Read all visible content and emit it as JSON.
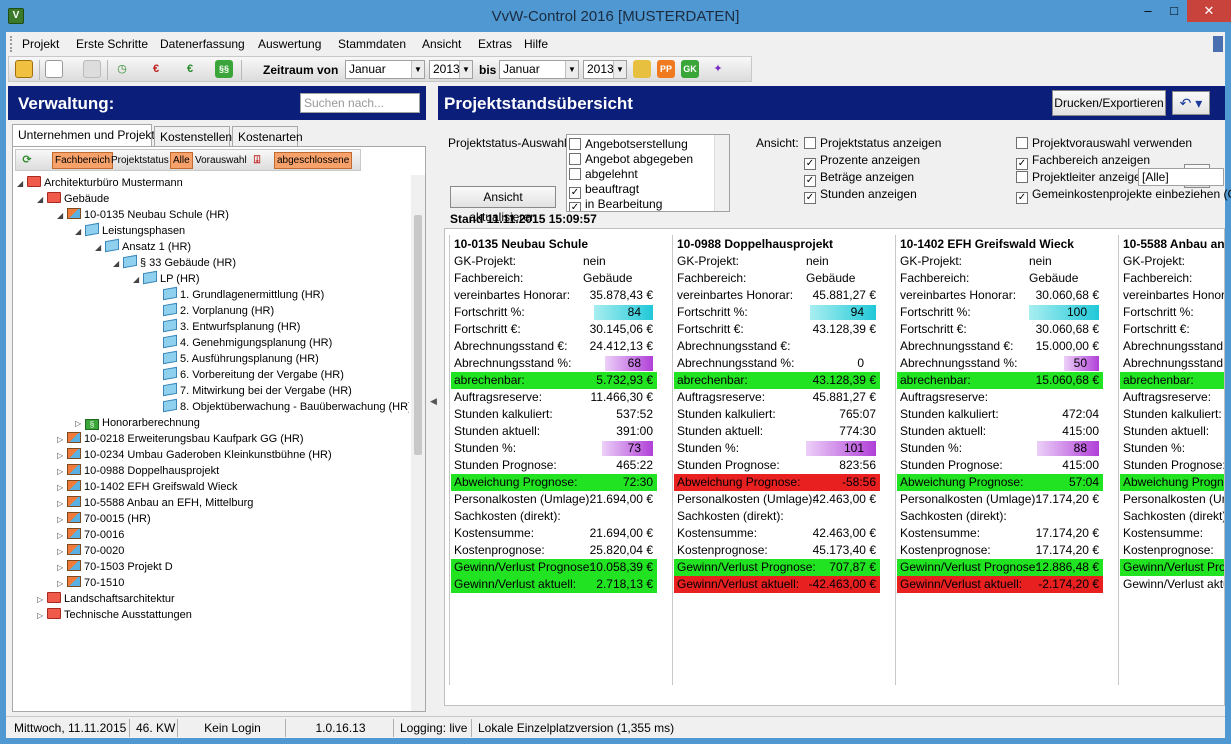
{
  "window": {
    "title": "VvW-Control 2016 [MUSTERDATEN]"
  },
  "menu": [
    "Projekt",
    "Erste Schritte",
    "Datenerfassung",
    "Auswertung",
    "Stammdaten",
    "Ansicht",
    "Extras",
    "Hilfe"
  ],
  "toolbar": {
    "zeitraum_label": "Zeitraum von",
    "from_month": "Januar",
    "from_year": "2013",
    "bis_label": "bis",
    "to_month": "Januar",
    "to_year": "2013"
  },
  "left": {
    "title": "Verwaltung:",
    "search_placeholder": "Suchen nach...",
    "tabs": [
      "Unternehmen und Projekte",
      "Kostenstellen",
      "Kostenarten"
    ],
    "filters": [
      "Fachbereich",
      "Projektstatus",
      "Alle",
      "Vorauswahl",
      "abgeschlossene"
    ],
    "tree": [
      "Architekturbüro Mustermann",
      "Gebäude",
      "10-0135 Neubau Schule (HR)",
      "Leistungsphasen",
      "Ansatz 1 (HR)",
      "§ 33 Gebäude (HR)",
      "LP (HR)",
      "1. Grundlagenermittlung (HR)",
      "2. Vorplanung (HR)",
      "3. Entwurfsplanung (HR)",
      "4. Genehmigungsplanung (HR)",
      "5. Ausführungsplanung (HR)",
      "6. Vorbereitung der Vergabe (HR)",
      "7. Mitwirkung bei der Vergabe (HR)",
      "8. Objektüberwachung - Bauüberwachung (HR)",
      "Honorarberechnung",
      "10-0218 Erweiterungsbau Kaufpark GG (HR)",
      "10-0234 Umbau Gaderoben Kleinkunstbühne (HR)",
      "10-0988 Doppelhausprojekt",
      "10-1402 EFH Greifswald Wieck",
      "10-5588 Anbau an EFH, Mittelburg",
      "70-0015 (HR)",
      "70-0016",
      "70-0020",
      "70-1503 Projekt D",
      "70-1510",
      "Landschaftsarchitektur",
      "Technische Ausstattungen"
    ]
  },
  "right": {
    "title": "Projektstandsübersicht",
    "print_button": "Drucken/Exportieren",
    "status_label": "Projektstatus-Auswahl:",
    "status_items": [
      {
        "label": "Angebotserstellung",
        "checked": false
      },
      {
        "label": "Angebot abgegeben",
        "checked": false
      },
      {
        "label": "abgelehnt",
        "checked": false
      },
      {
        "label": "beauftragt",
        "checked": true
      },
      {
        "label": "in Bearbeitung",
        "checked": true
      }
    ],
    "refresh_button": "Ansicht aktualisieren",
    "stand": "Stand 11.11.2015 15:09:57",
    "ansicht_label": "Ansicht:",
    "ansicht_options": [
      {
        "label": "Projektstatus anzeigen",
        "checked": false
      },
      {
        "label": "Prozente anzeigen",
        "checked": true
      },
      {
        "label": "Beträge anzeigen",
        "checked": true
      },
      {
        "label": "Stunden anzeigen",
        "checked": true
      }
    ],
    "other_options": [
      {
        "label": "Projektvorauswahl verwenden",
        "checked": false
      },
      {
        "label": "Fachbereich anzeigen",
        "checked": true
      },
      {
        "label": "Projektleiter anzeigen",
        "checked": false
      },
      {
        "label": "Gemeinkostenprojekte einbeziehen (GK)",
        "checked": true
      }
    ],
    "projektleiter_value": "[Alle]"
  },
  "row_labels": [
    "GK-Projekt:",
    "Fachbereich:",
    "vereinbartes Honorar:",
    "Fortschritt %:",
    "Fortschritt €:",
    "Abrechnungsstand €:",
    "Abrechnungsstand %:",
    "abrechenbar:",
    "Auftragsreserve:",
    "Stunden kalkuliert:",
    "Stunden aktuell:",
    "Stunden %:",
    "Stunden Prognose:",
    "Abweichung Prognose:",
    "Personalkosten (Umlage):",
    "Sachkosten (direkt):",
    "Kostensumme:",
    "Kostenprognose:",
    "Gewinn/Verlust Prognose:",
    "Gewinn/Verlust aktuell:"
  ],
  "cards": [
    {
      "title": "10-0135 Neubau Schule",
      "values": [
        "nein",
        "Gebäude",
        "35.878,43 €",
        "84",
        "30.145,06 €",
        "24.412,13 €",
        "68",
        "5.732,93 €",
        "11.466,30 €",
        "537:52",
        "391:00",
        "73",
        "465:22",
        "72:30",
        "21.694,00 €",
        "",
        "21.694,00 €",
        "25.820,04 €",
        "10.058,39 €",
        "2.718,13 €"
      ],
      "colors": [
        "",
        "",
        "",
        "",
        "",
        "",
        "",
        "green",
        "",
        "",
        "",
        "",
        "",
        "green",
        "",
        "",
        "",
        "",
        "green",
        "green"
      ]
    },
    {
      "title": "10-0988 Doppelhausprojekt",
      "values": [
        "nein",
        "Gebäude",
        "45.881,27 €",
        "94",
        "43.128,39 €",
        "",
        "0",
        "43.128,39 €",
        "45.881,27 €",
        "765:07",
        "774:30",
        "101",
        "823:56",
        "-58:56",
        "42.463,00 €",
        "",
        "42.463,00 €",
        "45.173,40 €",
        "707,87 €",
        "-42.463,00 €"
      ],
      "colors": [
        "",
        "",
        "",
        "",
        "",
        "",
        "",
        "green",
        "",
        "",
        "",
        "",
        "",
        "red",
        "",
        "",
        "",
        "",
        "green",
        "red"
      ]
    },
    {
      "title": "10-1402 EFH Greifswald Wieck",
      "values": [
        "nein",
        "Gebäude",
        "30.060,68 €",
        "100",
        "30.060,68 €",
        "15.000,00 €",
        "50",
        "15.060,68 €",
        "",
        "472:04",
        "415:00",
        "88",
        "415:00",
        "57:04",
        "17.174,20 €",
        "",
        "17.174,20 €",
        "17.174,20 €",
        "12.886,48 €",
        "-2.174,20 €"
      ],
      "colors": [
        "",
        "",
        "",
        "",
        "",
        "",
        "",
        "green",
        "",
        "",
        "",
        "",
        "",
        "green",
        "",
        "",
        "",
        "",
        "green",
        "red"
      ]
    },
    {
      "title": "10-5588 Anbau an",
      "values": [
        "",
        "",
        "",
        "",
        "",
        "",
        "",
        "",
        "",
        "",
        "",
        "",
        "",
        "",
        "",
        "",
        "",
        "",
        "",
        ""
      ],
      "colors": [
        "",
        "",
        "",
        "",
        "",
        "",
        "",
        "green",
        "",
        "",
        "",
        "",
        "",
        "green",
        "",
        "",
        "",
        "",
        "green",
        ""
      ]
    }
  ],
  "card4_labels": [
    "GK-Projekt:",
    "Fachbereich:",
    "vereinbartes Honorar:",
    "Fortschritt %:",
    "Fortschritt €:",
    "Abrechnungsstand €:",
    "Abrechnungsstand %:",
    "abrechenbar:",
    "Auftragsreserve:",
    "Stunden kalkuliert:",
    "Stunden aktuell:",
    "Stunden %:",
    "Stunden Prognose:",
    "Abweichung Prognose:",
    "Personalkosten (Umlage):",
    "Sachkosten (direkt):",
    "Kostensumme:",
    "Kostenprognose:",
    "Gewinn/Verlust Prognose:",
    "Gewinn/Verlust aktuell:"
  ],
  "statusbar": {
    "date": "Mittwoch, 11.11.2015",
    "week": "46. KW",
    "login": "Kein Login",
    "version": "1.0.16.13",
    "logging": "Logging: live",
    "mode": "Lokale Einzelplatzversion (1,355 ms)"
  },
  "colors": {
    "header_blue": "#0b1f7a",
    "green": "#22e322",
    "red": "#e82020"
  }
}
